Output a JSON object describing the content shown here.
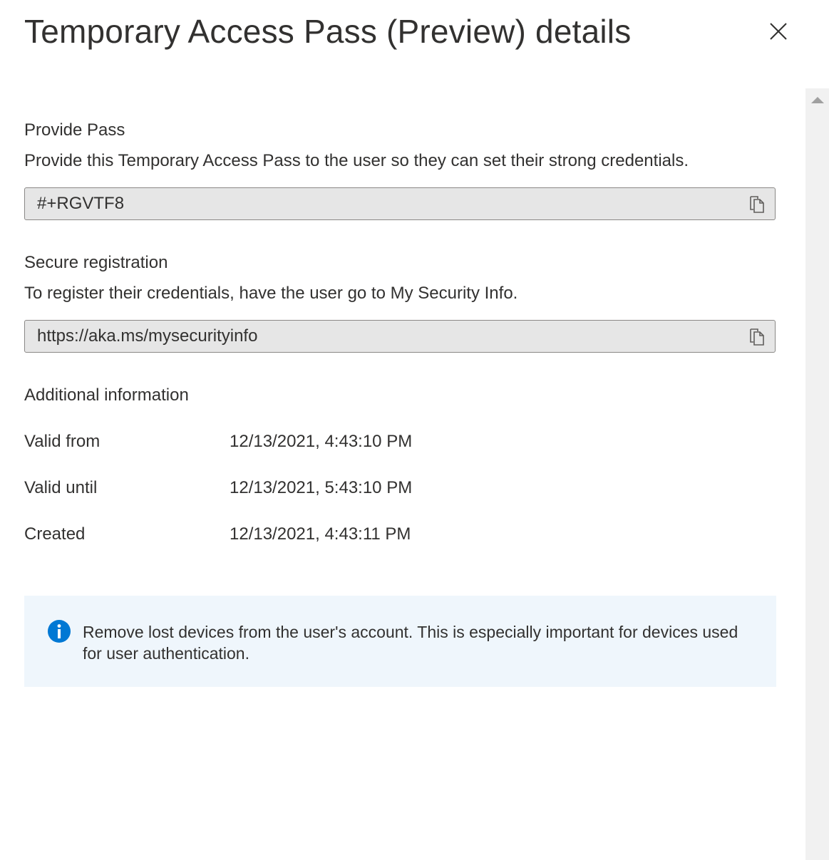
{
  "header": {
    "title": "Temporary Access Pass (Preview) details",
    "close_icon": "close-icon"
  },
  "provide_pass": {
    "title": "Provide Pass",
    "description": "Provide this Temporary Access Pass to the user so they can set their strong credentials.",
    "value": "#+RGVTF8",
    "copy_icon": "copy-icon"
  },
  "secure_registration": {
    "title": "Secure registration",
    "description": "To register their credentials, have the user go to My Security Info.",
    "value": "https://aka.ms/mysecurityinfo",
    "copy_icon": "copy-icon"
  },
  "additional_info": {
    "title": "Additional information",
    "rows": [
      {
        "label": "Valid from",
        "value": "12/13/2021, 4:43:10 PM"
      },
      {
        "label": "Valid until",
        "value": "12/13/2021, 5:43:10 PM"
      },
      {
        "label": "Created",
        "value": "12/13/2021, 4:43:11 PM"
      }
    ]
  },
  "info_banner": {
    "icon": "info-icon",
    "text": "Remove lost devices from the user's account. This is especially important for devices used for user authentication."
  },
  "colors": {
    "accent": "#0078d4",
    "field_background": "#e6e6e6",
    "banner_background": "#eff6fc",
    "text": "#323130"
  }
}
